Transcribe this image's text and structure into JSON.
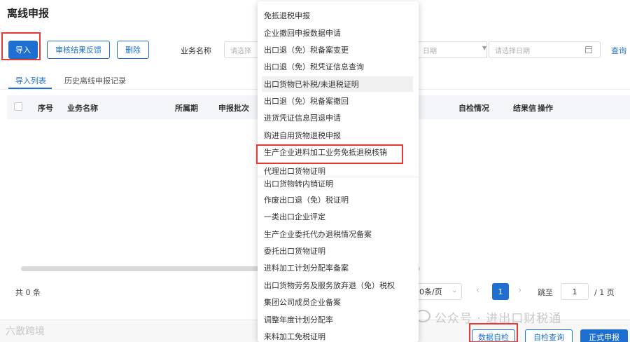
{
  "page": {
    "title": "离线申报"
  },
  "toolbar": {
    "import_label": "导入",
    "feedback_label": "审核结果反馈",
    "delete_label": "删除"
  },
  "filters": {
    "business_name_label": "业务名称",
    "business_name_placeholder": "请选择",
    "date_start_placeholder": "日期",
    "date_end_placeholder": "请选择日期",
    "query_label": "查询"
  },
  "tabs": [
    {
      "label": "导入列表"
    },
    {
      "label": "历史离线申报记录"
    }
  ],
  "table": {
    "columns": [
      "序号",
      "业务名称",
      "所属期",
      "申报批次",
      "自检情况",
      "结果信",
      "操作"
    ]
  },
  "pagination": {
    "total_text": "共 0 条",
    "page_size": "0条/页",
    "current_page": "1",
    "jump_label": "跳至",
    "jump_value": "1",
    "total_pages": "/ 1 页"
  },
  "bottom_buttons": {
    "self_check": "数据自检",
    "self_check_query": "自检查询",
    "formal_declare": "正式申报"
  },
  "watermark": {
    "text": "公众号 · 进出口财税通",
    "brand": "六散跨境"
  },
  "dropdown": {
    "items": [
      "免抵退税申报",
      "企业撤回申报数据申请",
      "出口退（免）税备案变更",
      "出口退（免）税凭证信息查询",
      "出口货物已补税/未退税证明",
      "出口退（免）税备案撤回",
      "进货凭证信息回退申请",
      "购进自用货物退税申报",
      "生产企业进料加工业务免抵退税核销",
      "代理出口货物证明",
      "出口货物转内销证明",
      "作废出口退（免）税证明",
      "一类出口企业评定",
      "生产企业委托代办退税情况备案",
      "委托出口货物证明",
      "进料加工计划分配率备案",
      "出口货物劳务及服务放弃退（免）税权",
      "集团公司成员企业备案",
      "调整年度计划分配率",
      "来料加工免税证明"
    ]
  }
}
